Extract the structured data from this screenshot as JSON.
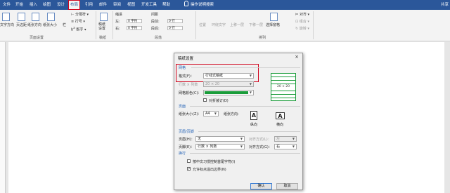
{
  "tabs": [
    "文件",
    "开始",
    "插入",
    "绘图",
    "设计",
    "布局",
    "引用",
    "邮件",
    "审阅",
    "视图",
    "开发工具",
    "帮助"
  ],
  "tell_me": "操作说明搜索",
  "user": "共享",
  "colors": {
    "ribbon": "#2b579a",
    "highlight": "#d0021b",
    "grid_green": "#1a9c3a"
  },
  "ribbon": {
    "page_setup": {
      "items": [
        "文字方向",
        "页边距",
        "纸张方向",
        "纸张大小",
        "栏"
      ],
      "breaks": "分隔符",
      "line_numbers": "行号",
      "hyphenation": "断字",
      "label": "页面设置"
    },
    "draft": {
      "item": "稿纸设置",
      "label": "稿纸"
    },
    "indent": {
      "title": "缩进",
      "left_label": "左:",
      "left_value": "0 字符",
      "right_label": "右:",
      "right_value": "0 字符"
    },
    "spacing": {
      "title": "间距",
      "before_label": "段前:",
      "before_value": "0 行",
      "after_label": "段后:",
      "after_value": "0 行"
    },
    "paragraph_label": "段落",
    "arrange": {
      "items": [
        "位置",
        "环绕文字",
        "上移一层",
        "下移一层",
        "选择窗格"
      ],
      "right_items": [
        "对齐",
        "组合",
        "旋转"
      ],
      "label": "排列"
    }
  },
  "dialog": {
    "title": "稿纸设置",
    "close": "×",
    "grid_section": "网格",
    "format_label": "格式(F)：",
    "format_value": "行线式稿纸",
    "rows_cols_label": "行数 × 列数",
    "rows_cols_value": "20 × 20",
    "grid_color_label": "网格颜色(C)：",
    "fold_label": "对折装订(D)",
    "preview_text": "20 × 20",
    "page_section": "页面",
    "paper_size_label": "纸张大小(Z)：",
    "paper_size_value": "A4",
    "orientation_label": "纸张方向:",
    "portrait_label": "纵向",
    "landscape_label": "横向",
    "header_footer_section": "页眉/页脚",
    "header_label": "页眉(H)：",
    "header_value": "无",
    "header_align_label": "对齐方式(L)：",
    "header_align_value": "左",
    "footer_label": "页脚(E)：",
    "footer_value": "行数 × 列数",
    "footer_align_label": "对齐方式(G)：",
    "footer_align_value": "右",
    "wrap_section": "换行",
    "opt1_label": "按中文习惯控制首尾字符(I)",
    "opt2_label": "允许标点溢出边界(N)",
    "ok": "确认",
    "cancel": "取消"
  }
}
